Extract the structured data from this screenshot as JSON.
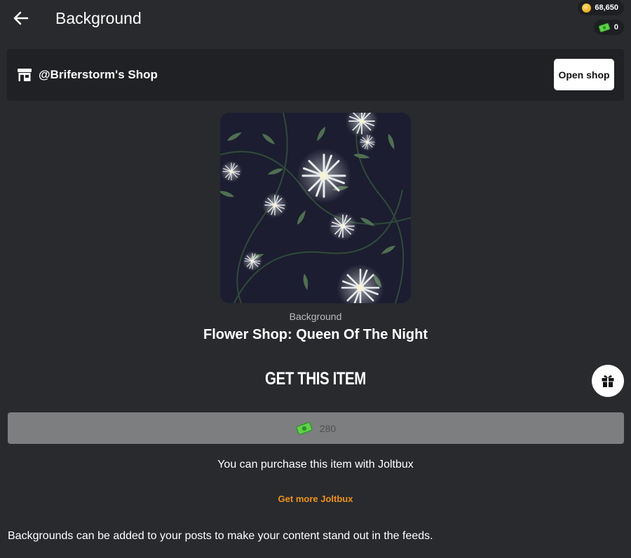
{
  "header": {
    "title": "Background",
    "back_icon": "arrow-left-icon"
  },
  "wallet": {
    "coins": "68,650",
    "joltbux": "0",
    "coin_icon": "coin-icon",
    "joltbux_icon": "joltbux-icon"
  },
  "shop": {
    "name": "@Briferstorm's Shop",
    "icon": "store-icon",
    "open_label": "Open shop"
  },
  "item": {
    "type": "Background",
    "title": "Flower Shop: Queen Of The Night",
    "preview": "flower-pattern-image"
  },
  "purchase": {
    "heading": "GET THIS ITEM",
    "price": "280",
    "note": "You can purchase this item with Joltbux",
    "get_more": "Get more Joltbux",
    "gift_icon": "gift-icon"
  },
  "description": "Backgrounds can be added to your posts to make your content stand out in the feeds.",
  "colors": {
    "background": "#282a2e",
    "bar": "#1f2124",
    "accent": "#f0921a",
    "button_disabled": "#7d7e80"
  }
}
